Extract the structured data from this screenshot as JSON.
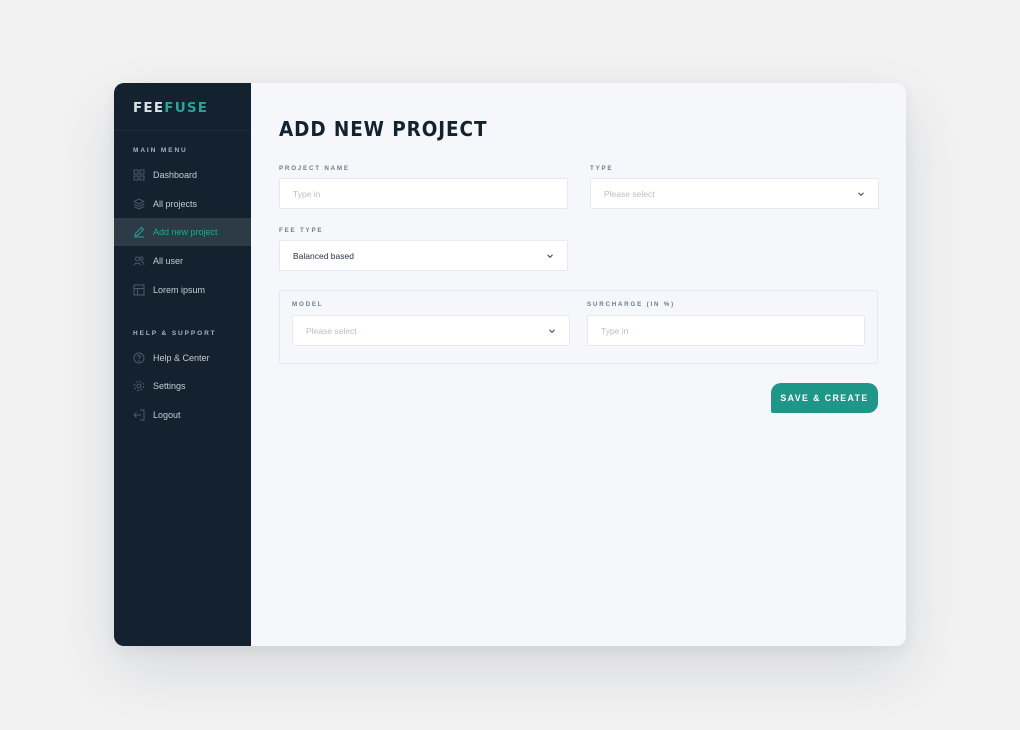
{
  "app": {
    "logo_part1": "FEE",
    "logo_part2": "FUSE",
    "accent_color": "#1e9688",
    "sidebar_bg": "#14212e"
  },
  "sidebar": {
    "main_menu_label": "MAIN MENU",
    "main_items": [
      {
        "label": "Dashboard",
        "icon": "dashboard-grid-icon",
        "active": false
      },
      {
        "label": "All projects",
        "icon": "layers-icon",
        "active": false
      },
      {
        "label": "Add new project",
        "icon": "pencil-icon",
        "active": true
      },
      {
        "label": "All user",
        "icon": "users-icon",
        "active": false
      },
      {
        "label": "Lorem ipsum",
        "icon": "layout-icon",
        "active": false
      }
    ],
    "help_label": "HELP & SUPPORT",
    "help_items": [
      {
        "label": "Help & Center",
        "icon": "help-circle-icon"
      },
      {
        "label": "Settings",
        "icon": "gear-icon"
      },
      {
        "label": "Logout",
        "icon": "logout-icon"
      }
    ]
  },
  "form": {
    "title": "ADD NEW PROJECT",
    "project_name": {
      "label": "PROJECT NAME",
      "placeholder": "Type in",
      "value": ""
    },
    "type": {
      "label": "TYPE",
      "placeholder": "Please select",
      "value": ""
    },
    "fee_type": {
      "label": "FEE TYPE",
      "value": "Balanced based"
    },
    "model": {
      "label": "MODEL",
      "placeholder": "Please select",
      "value": ""
    },
    "surcharge": {
      "label": "SURCHARGE (IN %)",
      "placeholder": "Type in",
      "value": ""
    },
    "submit_label": "SAVE & CREATE"
  }
}
